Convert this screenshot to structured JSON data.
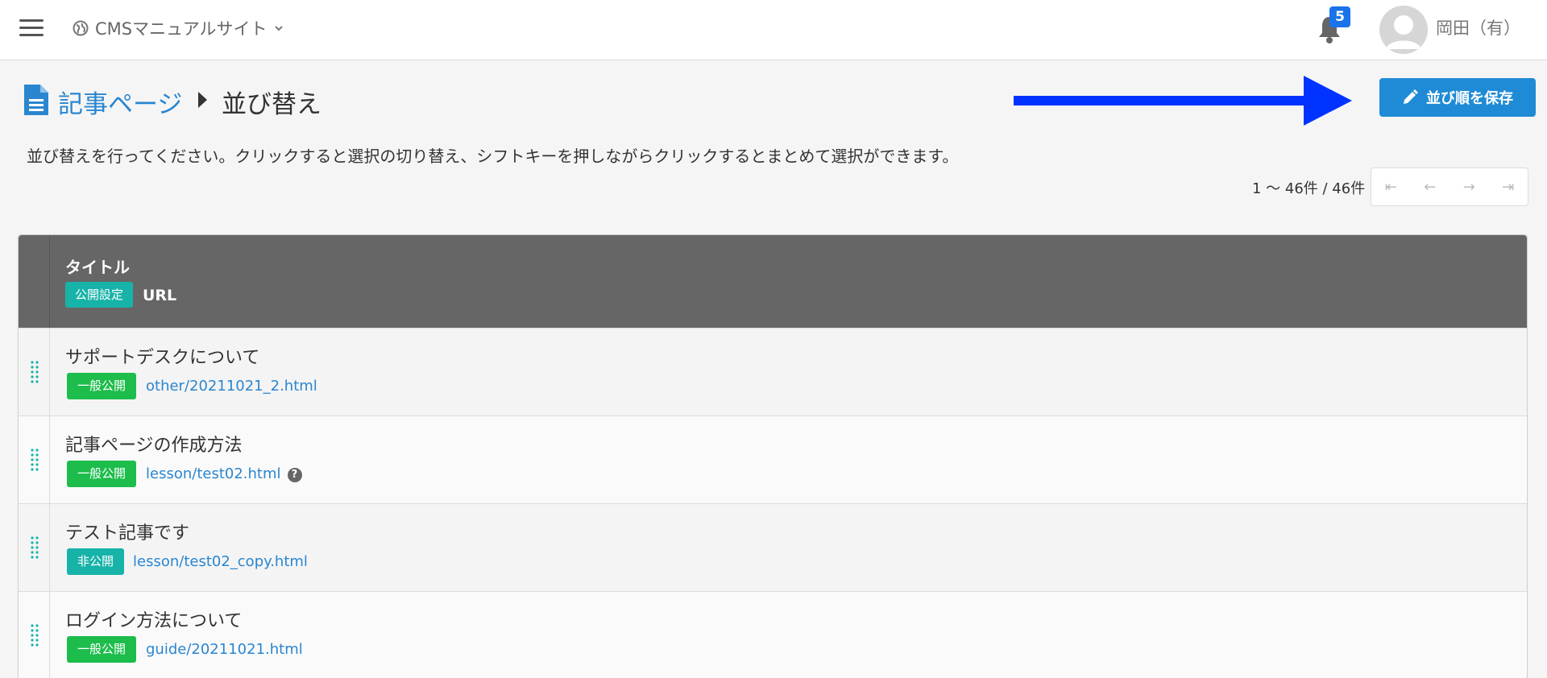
{
  "header": {
    "site_name": "CMSマニュアルサイト",
    "notification_count": "5",
    "user_name": "岡田（有）"
  },
  "page": {
    "breadcrumb_link": "記事ページ",
    "breadcrumb_current": "並び替え",
    "save_button": "並び順を保存",
    "instruction": "並び替えを行ってください。クリックすると選択の切り替え、シフトキーを押しながらクリックするとまとめて選択ができます。",
    "pager_count": "1 〜 46件 / 46件"
  },
  "table": {
    "col_title": "タイトル",
    "col_pub": "公開設定",
    "col_url": "URL",
    "rows": [
      {
        "title": "サポートデスクについて",
        "status": "一般公開",
        "url": "other/20211021_2.html"
      },
      {
        "title": "記事ページの作成方法",
        "status": "一般公開",
        "url": "lesson/test02.html"
      },
      {
        "title": "テスト記事です",
        "status": "非公開",
        "url": "lesson/test02_copy.html"
      },
      {
        "title": "ログイン方法について",
        "status": "一般公開",
        "url": "guide/20211021.html"
      }
    ]
  },
  "icons": {
    "help": "?"
  },
  "colors": {
    "accent_blue": "#1f8bd6",
    "link_blue": "#2a86d0",
    "badge_public": "#1dbd4c",
    "badge_private": "#17b3a8",
    "header_gray": "#666666",
    "annotation_arrow": "#0033ff"
  }
}
